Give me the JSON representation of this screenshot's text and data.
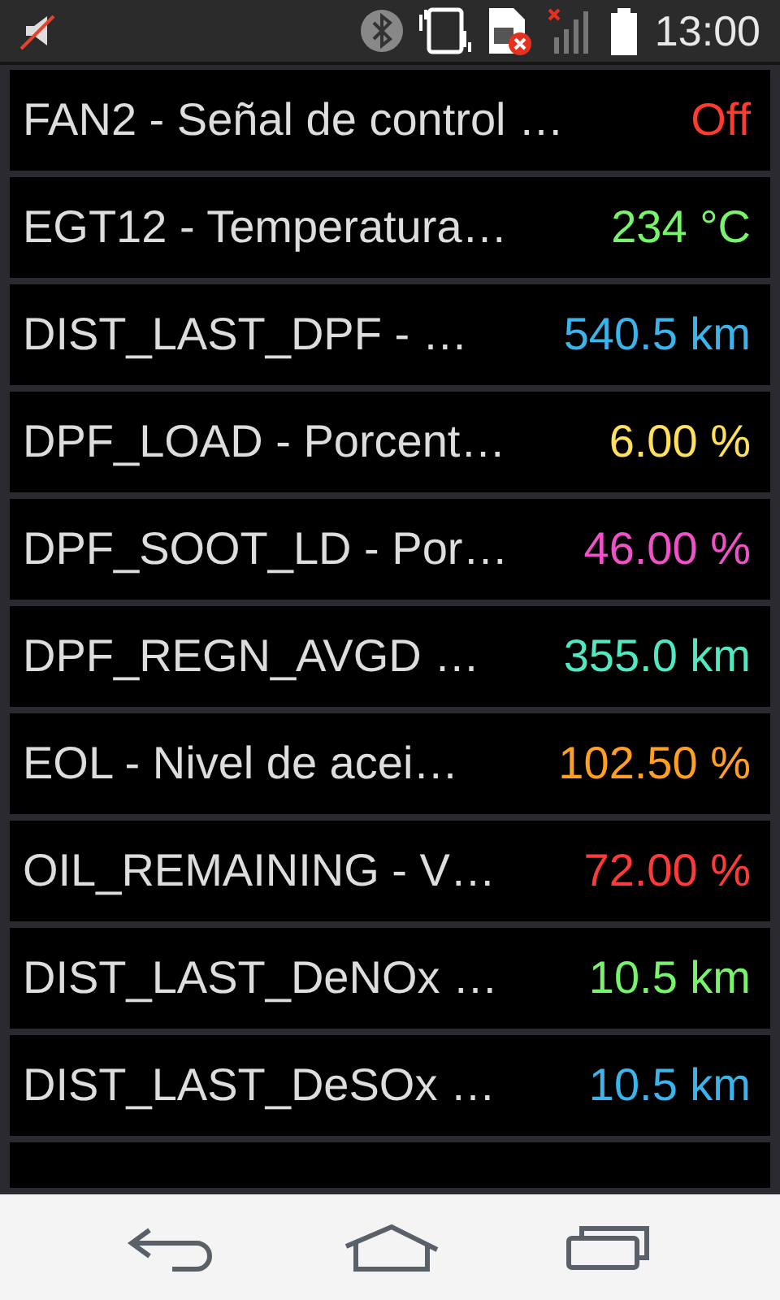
{
  "status_bar": {
    "time": "13:00"
  },
  "rows": [
    {
      "label": "FAN2 - Señal de control …",
      "value": "Off",
      "color": "#ff3b30"
    },
    {
      "label": "EGT12 - Temperatura…",
      "value": "234 °C",
      "color": "#77f46a"
    },
    {
      "label": "DIST_LAST_DPF - …",
      "value": "540.5 km",
      "color": "#3ab4ea"
    },
    {
      "label": "DPF_LOAD - Porcent…",
      "value": "6.00 %",
      "color": "#ffe05a"
    },
    {
      "label": "DPF_SOOT_LD - Por…",
      "value": "46.00 %",
      "color": "#f050c8"
    },
    {
      "label": "DPF_REGN_AVGD …",
      "value": "355.0 km",
      "color": "#50e8c0"
    },
    {
      "label": "EOL - Nivel de acei…",
      "value": "102.50 %",
      "color": "#ffa020"
    },
    {
      "label": "OIL_REMAINING - V…",
      "value": "72.00 %",
      "color": "#ff3a3a"
    },
    {
      "label": "DIST_LAST_DeNOx …",
      "value": "10.5 km",
      "color": "#77f46a"
    },
    {
      "label": "DIST_LAST_DeSOx …",
      "value": "10.5 km",
      "color": "#3ab4ea"
    }
  ]
}
